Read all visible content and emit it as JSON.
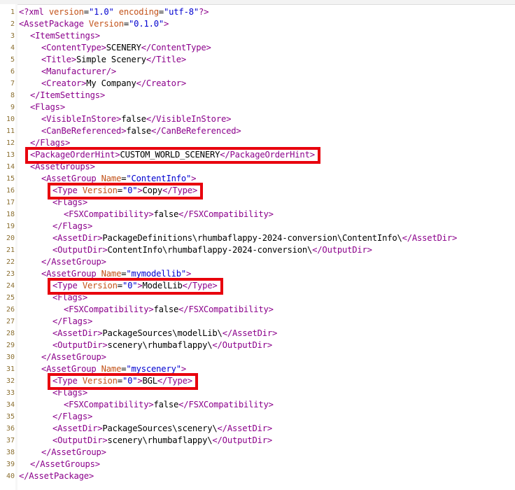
{
  "editor": {
    "colors": {
      "tag": "#8b008b",
      "text": "#000000",
      "attr_name": "#c3531a",
      "attr_value": "#0000d0",
      "line_number": "#8a6e2f",
      "highlight_box": "#e8000d"
    },
    "lines": [
      {
        "num": "1",
        "indent": 0,
        "segs": [
          {
            "t": "<?xml",
            "c": "tag"
          },
          {
            "t": " version",
            "c": "attr_name"
          },
          {
            "t": "=",
            "c": "text"
          },
          {
            "t": "\"1.0\"",
            "c": "attr_value"
          },
          {
            "t": " encoding",
            "c": "attr_name"
          },
          {
            "t": "=",
            "c": "text"
          },
          {
            "t": "\"utf-8\"",
            "c": "attr_value"
          },
          {
            "t": "?>",
            "c": "tag"
          }
        ]
      },
      {
        "num": "2",
        "indent": 0,
        "segs": [
          {
            "t": "<AssetPackage",
            "c": "tag"
          },
          {
            "t": " Version",
            "c": "attr_name"
          },
          {
            "t": "=",
            "c": "text"
          },
          {
            "t": "\"0.1.0\"",
            "c": "attr_value"
          },
          {
            "t": ">",
            "c": "tag"
          }
        ]
      },
      {
        "num": "3",
        "indent": 1,
        "segs": [
          {
            "t": "<ItemSettings>",
            "c": "tag"
          }
        ]
      },
      {
        "num": "4",
        "indent": 2,
        "segs": [
          {
            "t": "<ContentType>",
            "c": "tag"
          },
          {
            "t": "SCENERY",
            "c": "text"
          },
          {
            "t": "</ContentType>",
            "c": "tag"
          }
        ]
      },
      {
        "num": "5",
        "indent": 2,
        "segs": [
          {
            "t": "<Title>",
            "c": "tag"
          },
          {
            "t": "Simple Scenery",
            "c": "text"
          },
          {
            "t": "</Title>",
            "c": "tag"
          }
        ]
      },
      {
        "num": "6",
        "indent": 2,
        "segs": [
          {
            "t": "<Manufacturer/>",
            "c": "tag"
          }
        ]
      },
      {
        "num": "7",
        "indent": 2,
        "segs": [
          {
            "t": "<Creator>",
            "c": "tag"
          },
          {
            "t": "My Company",
            "c": "text"
          },
          {
            "t": "</Creator>",
            "c": "tag"
          }
        ]
      },
      {
        "num": "8",
        "indent": 1,
        "segs": [
          {
            "t": "</ItemSettings>",
            "c": "tag"
          }
        ]
      },
      {
        "num": "9",
        "indent": 1,
        "segs": [
          {
            "t": "<Flags>",
            "c": "tag"
          }
        ]
      },
      {
        "num": "10",
        "indent": 2,
        "segs": [
          {
            "t": "<VisibleInStore>",
            "c": "tag"
          },
          {
            "t": "false",
            "c": "text"
          },
          {
            "t": "</VisibleInStore>",
            "c": "tag"
          }
        ]
      },
      {
        "num": "11",
        "indent": 2,
        "segs": [
          {
            "t": "<CanBeReferenced>",
            "c": "tag"
          },
          {
            "t": "false",
            "c": "text"
          },
          {
            "t": "</CanBeReferenced>",
            "c": "tag"
          }
        ]
      },
      {
        "num": "12",
        "indent": 1,
        "segs": [
          {
            "t": "</Flags>",
            "c": "tag"
          }
        ]
      },
      {
        "num": "13",
        "indent": 1,
        "segs": [
          {
            "t": "<PackageOrderHint>",
            "c": "tag"
          },
          {
            "t": "CUSTOM_WORLD_SCENERY",
            "c": "text"
          },
          {
            "t": "</PackageOrderHint>",
            "c": "tag"
          }
        ]
      },
      {
        "num": "14",
        "indent": 1,
        "segs": [
          {
            "t": "<AssetGroups>",
            "c": "tag"
          }
        ]
      },
      {
        "num": "15",
        "indent": 2,
        "segs": [
          {
            "t": "<AssetGroup",
            "c": "tag"
          },
          {
            "t": " Name",
            "c": "attr_name"
          },
          {
            "t": "=",
            "c": "text"
          },
          {
            "t": "\"ContentInfo\"",
            "c": "attr_value"
          },
          {
            "t": ">",
            "c": "tag"
          }
        ]
      },
      {
        "num": "16",
        "indent": 3,
        "segs": [
          {
            "t": "<Type",
            "c": "tag"
          },
          {
            "t": " Version",
            "c": "attr_name"
          },
          {
            "t": "=",
            "c": "text"
          },
          {
            "t": "\"0\"",
            "c": "attr_value"
          },
          {
            "t": ">",
            "c": "tag"
          },
          {
            "t": "Copy",
            "c": "text"
          },
          {
            "t": "</Type>",
            "c": "tag"
          }
        ]
      },
      {
        "num": "17",
        "indent": 3,
        "segs": [
          {
            "t": "<Flags>",
            "c": "tag"
          }
        ]
      },
      {
        "num": "18",
        "indent": 4,
        "segs": [
          {
            "t": "<FSXCompatibility>",
            "c": "tag"
          },
          {
            "t": "false",
            "c": "text"
          },
          {
            "t": "</FSXCompatibility>",
            "c": "tag"
          }
        ]
      },
      {
        "num": "19",
        "indent": 3,
        "segs": [
          {
            "t": "</Flags>",
            "c": "tag"
          }
        ]
      },
      {
        "num": "20",
        "indent": 3,
        "segs": [
          {
            "t": "<AssetDir>",
            "c": "tag"
          },
          {
            "t": "PackageDefinitions\\rhumbaflappy-2024-conversion\\ContentInfo\\",
            "c": "text"
          },
          {
            "t": "</AssetDir>",
            "c": "tag"
          }
        ]
      },
      {
        "num": "21",
        "indent": 3,
        "segs": [
          {
            "t": "<OutputDir>",
            "c": "tag"
          },
          {
            "t": "ContentInfo\\rhumbaflappy-2024-conversion\\",
            "c": "text"
          },
          {
            "t": "</OutputDir>",
            "c": "tag"
          }
        ]
      },
      {
        "num": "22",
        "indent": 2,
        "segs": [
          {
            "t": "</AssetGroup>",
            "c": "tag"
          }
        ]
      },
      {
        "num": "23",
        "indent": 2,
        "segs": [
          {
            "t": "<AssetGroup",
            "c": "tag"
          },
          {
            "t": " Name",
            "c": "attr_name"
          },
          {
            "t": "=",
            "c": "text"
          },
          {
            "t": "\"mymodellib\"",
            "c": "attr_value"
          },
          {
            "t": ">",
            "c": "tag"
          }
        ]
      },
      {
        "num": "24",
        "indent": 3,
        "segs": [
          {
            "t": "<Type",
            "c": "tag"
          },
          {
            "t": " Version",
            "c": "attr_name"
          },
          {
            "t": "=",
            "c": "text"
          },
          {
            "t": "\"0\"",
            "c": "attr_value"
          },
          {
            "t": ">",
            "c": "tag"
          },
          {
            "t": "ModelLib",
            "c": "text"
          },
          {
            "t": "</Type>",
            "c": "tag"
          }
        ]
      },
      {
        "num": "25",
        "indent": 3,
        "segs": [
          {
            "t": "<Flags>",
            "c": "tag"
          }
        ]
      },
      {
        "num": "26",
        "indent": 4,
        "segs": [
          {
            "t": "<FSXCompatibility>",
            "c": "tag"
          },
          {
            "t": "false",
            "c": "text"
          },
          {
            "t": "</FSXCompatibility>",
            "c": "tag"
          }
        ]
      },
      {
        "num": "27",
        "indent": 3,
        "segs": [
          {
            "t": "</Flags>",
            "c": "tag"
          }
        ]
      },
      {
        "num": "28",
        "indent": 3,
        "segs": [
          {
            "t": "<AssetDir>",
            "c": "tag"
          },
          {
            "t": "PackageSources\\modelLib\\",
            "c": "text"
          },
          {
            "t": "</AssetDir>",
            "c": "tag"
          }
        ]
      },
      {
        "num": "29",
        "indent": 3,
        "segs": [
          {
            "t": "<OutputDir>",
            "c": "tag"
          },
          {
            "t": "scenery\\rhumbaflappy\\",
            "c": "text"
          },
          {
            "t": "</OutputDir>",
            "c": "tag"
          }
        ]
      },
      {
        "num": "30",
        "indent": 2,
        "segs": [
          {
            "t": "</AssetGroup>",
            "c": "tag"
          }
        ]
      },
      {
        "num": "31",
        "indent": 2,
        "segs": [
          {
            "t": "<AssetGroup",
            "c": "tag"
          },
          {
            "t": " Name",
            "c": "attr_name"
          },
          {
            "t": "=",
            "c": "text"
          },
          {
            "t": "\"myscenery\"",
            "c": "attr_value"
          },
          {
            "t": ">",
            "c": "tag"
          }
        ]
      },
      {
        "num": "32",
        "indent": 3,
        "segs": [
          {
            "t": "<Type",
            "c": "tag"
          },
          {
            "t": " Version",
            "c": "attr_name"
          },
          {
            "t": "=",
            "c": "text"
          },
          {
            "t": "\"0\"",
            "c": "attr_value"
          },
          {
            "t": ">",
            "c": "tag"
          },
          {
            "t": "BGL",
            "c": "text"
          },
          {
            "t": "</Type>",
            "c": "tag"
          }
        ]
      },
      {
        "num": "33",
        "indent": 3,
        "segs": [
          {
            "t": "<Flags>",
            "c": "tag"
          }
        ]
      },
      {
        "num": "34",
        "indent": 4,
        "segs": [
          {
            "t": "<FSXCompatibility>",
            "c": "tag"
          },
          {
            "t": "false",
            "c": "text"
          },
          {
            "t": "</FSXCompatibility>",
            "c": "tag"
          }
        ]
      },
      {
        "num": "35",
        "indent": 3,
        "segs": [
          {
            "t": "</Flags>",
            "c": "tag"
          }
        ]
      },
      {
        "num": "36",
        "indent": 3,
        "segs": [
          {
            "t": "<AssetDir>",
            "c": "tag"
          },
          {
            "t": "PackageSources\\scenery\\",
            "c": "text"
          },
          {
            "t": "</AssetDir>",
            "c": "tag"
          }
        ]
      },
      {
        "num": "37",
        "indent": 3,
        "segs": [
          {
            "t": "<OutputDir>",
            "c": "tag"
          },
          {
            "t": "scenery\\rhumbaflappy\\",
            "c": "text"
          },
          {
            "t": "</OutputDir>",
            "c": "tag"
          }
        ]
      },
      {
        "num": "38",
        "indent": 2,
        "segs": [
          {
            "t": "</AssetGroup>",
            "c": "tag"
          }
        ]
      },
      {
        "num": "39",
        "indent": 1,
        "segs": [
          {
            "t": "</AssetGroups>",
            "c": "tag"
          }
        ]
      },
      {
        "num": "40",
        "indent": 0,
        "segs": [
          {
            "t": "</AssetPackage>",
            "c": "tag"
          }
        ]
      }
    ],
    "highlighted_lines": [
      "13",
      "16",
      "24",
      "32"
    ]
  }
}
